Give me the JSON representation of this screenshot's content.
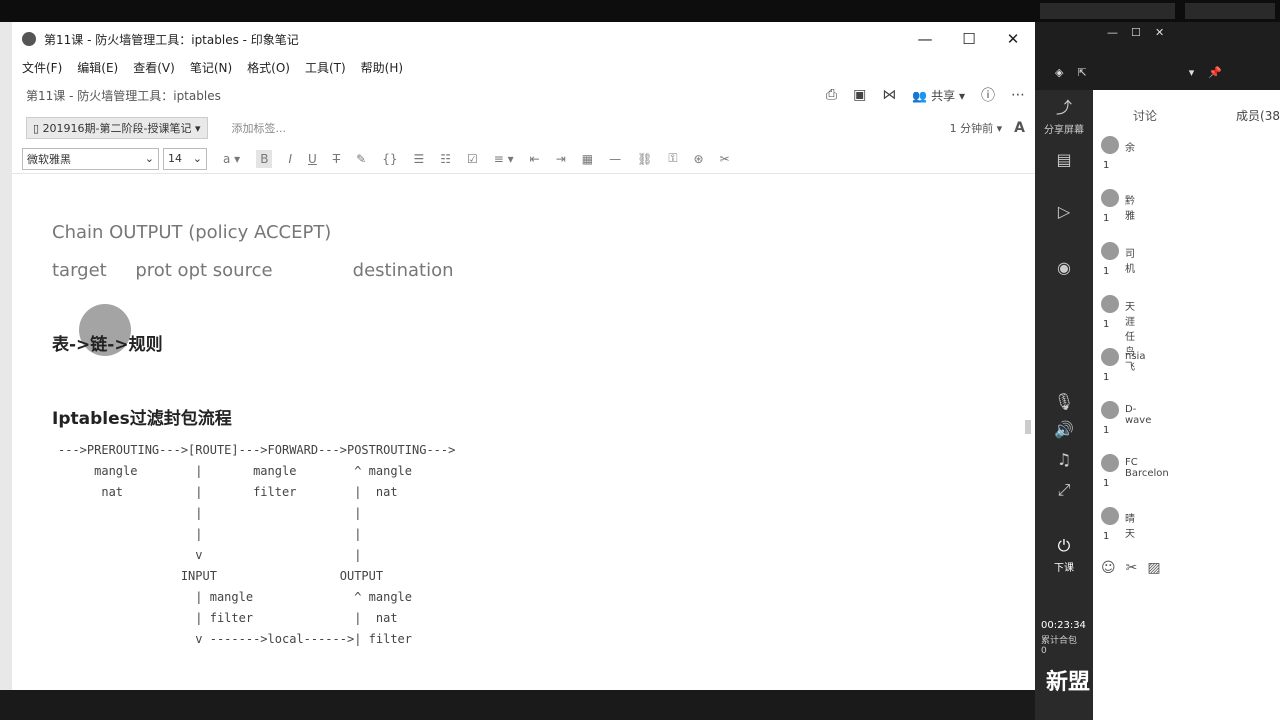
{
  "window": {
    "title": "第11课 - 防火墙管理工具：iptables - 印象笔记",
    "minimize": "—",
    "maximize": "☐",
    "close": "✕"
  },
  "menu": [
    "文件(F)",
    "编辑(E)",
    "查看(V)",
    "笔记(N)",
    "格式(O)",
    "工具(T)",
    "帮助(H)"
  ],
  "note": {
    "title": "第11课 - 防火墙管理工具：iptables",
    "share_label": "共享",
    "notebook": "201916期-第二阶段-授课笔记",
    "add_tag": "添加标签...",
    "updated": "1 分钟前"
  },
  "toolbar": {
    "font": "微软雅黑",
    "size": "14"
  },
  "content": {
    "chain": "Chain OUTPUT (policy ACCEPT)",
    "columns": "target     prot opt source              destination",
    "table_chain": "表->链->规则",
    "heading": "Iptables过滤封包流程",
    "diagram": "--->PREROUTING--->[ROUTE]--->FORWARD--->POSTROUTING--->\n     mangle        |       mangle        ^ mangle\n      nat          |       filter        |  nat\n                   |                     |\n                   |                     |\n                   v                     |\n                 INPUT                 OUTPUT\n                   | mangle              ^ mangle\n                   | filter              |  nat\n                   v ------->local------>| filter"
  },
  "side": {
    "share_screen": "分享屏幕",
    "tab_discuss": "讨论",
    "tab_members": "成员(38",
    "users": [
      {
        "name": "余",
        "count": "1"
      },
      {
        "name": "黔雅",
        "count": "1"
      },
      {
        "name": "司机",
        "count": "1"
      },
      {
        "name": "天涯任鸟飞",
        "count": "1"
      },
      {
        "name": "nsia",
        "count": "1"
      },
      {
        "name": "D-wave",
        "count": "1"
      },
      {
        "name": "FC Barcelon",
        "count": "1"
      },
      {
        "name": "晴天",
        "count": "1"
      }
    ],
    "leave": "下课",
    "timer": "00:23:34",
    "stats1": "累计合包",
    "stats2": "0"
  },
  "watermark": "新盟"
}
